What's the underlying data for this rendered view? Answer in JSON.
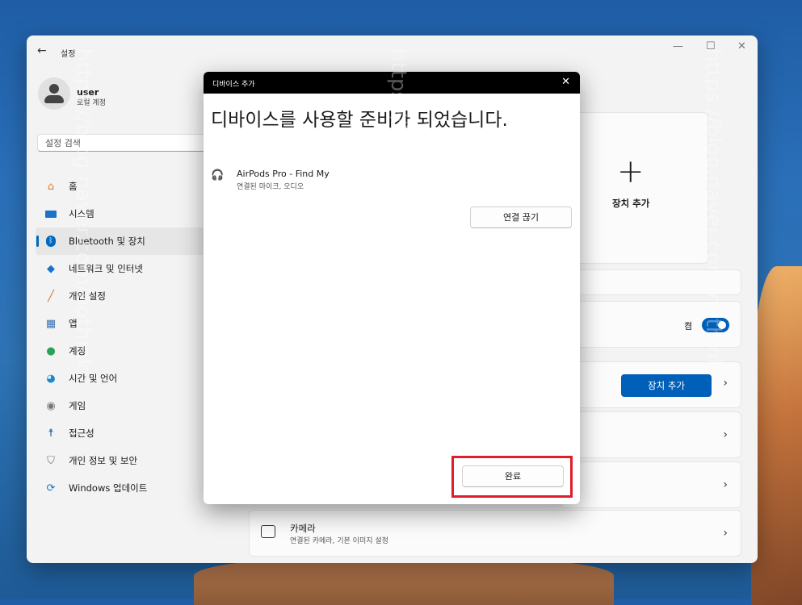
{
  "window": {
    "back_glyph": "←",
    "title": "설정",
    "controls": [
      "—",
      "☐",
      "✕"
    ]
  },
  "profile": {
    "name": "user",
    "account_type": "로컬 계정"
  },
  "search": {
    "placeholder": "설정 검색"
  },
  "nav": {
    "items": [
      {
        "label": "홈",
        "icon": "home-icon"
      },
      {
        "label": "시스템",
        "icon": "system-icon"
      },
      {
        "label": "Bluetooth 및 장치",
        "icon": "bluetooth-icon",
        "selected": true
      },
      {
        "label": "네트워크 및 인터넷",
        "icon": "wifi-icon"
      },
      {
        "label": "개인 설정",
        "icon": "brush-icon"
      },
      {
        "label": "앱",
        "icon": "apps-icon"
      },
      {
        "label": "계정",
        "icon": "account-icon"
      },
      {
        "label": "시간 및 언어",
        "icon": "globe-clock-icon"
      },
      {
        "label": "게임",
        "icon": "gamepad-icon"
      },
      {
        "label": "접근성",
        "icon": "accessibility-icon"
      },
      {
        "label": "개인 정보 및 보안",
        "icon": "shield-icon"
      },
      {
        "label": "Windows 업데이트",
        "icon": "update-icon"
      }
    ]
  },
  "main": {
    "add_device_tile_label": "장치 추가",
    "add_device_plus": "+",
    "bluetooth_state": "켬",
    "add_device_button": "장치 추가",
    "chevron": "›",
    "camera": {
      "title": "카메라",
      "subtitle": "연결된 카메라, 기본 이미지 설정"
    }
  },
  "dialog": {
    "title": "디바이스 추가",
    "close_glyph": "✕",
    "heading": "디바이스를 사용할 준비가 되었습니다.",
    "device_name": "AirPods Pro - Find My",
    "device_sub": "연결된 마이크, 오디오",
    "disconnect_label": "연결 끊기",
    "done_label": "완료"
  },
  "watermark": "https://blog.naver.com/nothink",
  "colors": {
    "accent": "#005fb8",
    "highlight": "#e01d2a"
  }
}
